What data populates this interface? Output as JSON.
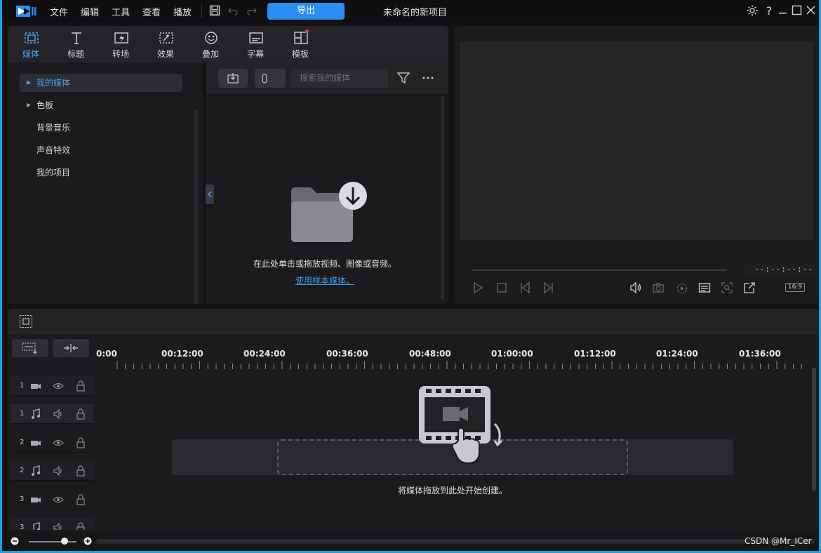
{
  "menu": {
    "file": "文件",
    "edit": "编辑",
    "tools": "工具",
    "view": "查看",
    "play": "播放"
  },
  "toolbar": {
    "export_label": "导出",
    "project_title": "未命名的新项目"
  },
  "room_tabs": [
    {
      "label": "媒体",
      "icon": "media-icon",
      "active": true
    },
    {
      "label": "标题",
      "icon": "title-icon"
    },
    {
      "label": "转场",
      "icon": "transition-icon"
    },
    {
      "label": "效果",
      "icon": "effect-icon"
    },
    {
      "label": "叠加",
      "icon": "overlay-icon"
    },
    {
      "label": "字幕",
      "icon": "subtitle-icon"
    },
    {
      "label": "模板",
      "icon": "template-icon",
      "badge": true
    }
  ],
  "library_tree": [
    {
      "label": "我的媒体",
      "expandable": true,
      "selected": true
    },
    {
      "label": "色板",
      "expandable": true
    },
    {
      "label": "背景音乐"
    },
    {
      "label": "声音特效"
    },
    {
      "label": "我的项目"
    }
  ],
  "media": {
    "search_placeholder": "搜索我的媒体",
    "empty_text": "在此处单击或拖放视频、图像或音频。",
    "sample_link": "使用样本媒体。"
  },
  "preview": {
    "timecode": "--:--:--:--",
    "aspect_ratio": "16:9"
  },
  "timeline": {
    "ruler_labels": [
      "0:00",
      "00:12:00",
      "00:24:00",
      "00:36:00",
      "00:48:00",
      "01:00:00",
      "01:12:00",
      "01:24:00",
      "01:36:00"
    ],
    "tracks": [
      {
        "num": "1",
        "type": "video"
      },
      {
        "num": "1",
        "type": "audio"
      },
      {
        "num": "2",
        "type": "video"
      },
      {
        "num": "2",
        "type": "audio"
      },
      {
        "num": "3",
        "type": "video"
      },
      {
        "num": "3",
        "type": "audio"
      }
    ],
    "drop_text": "将媒体拖放到此处开始创建。"
  },
  "watermark": "CSDN @Mr_ICer",
  "colors": {
    "accent": "#2b8ef0",
    "link": "#3d9af0",
    "active_tab": "#4aa3f5",
    "window_border": "#1ea0e6"
  }
}
